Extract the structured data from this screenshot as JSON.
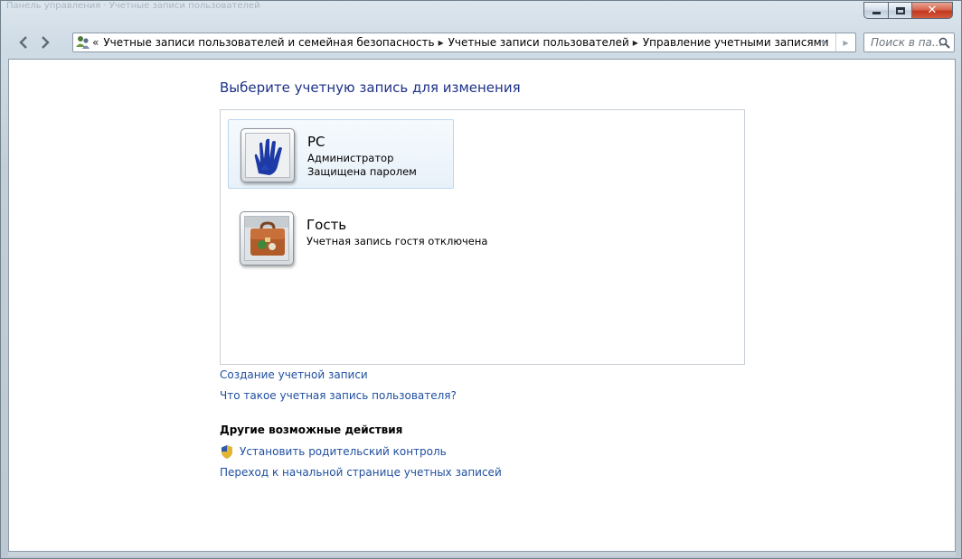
{
  "window": {
    "ghost_title": "Панель управления · Учетные записи пользователей"
  },
  "nav": {
    "crumb_lead": "«",
    "breadcrumbs": [
      "Учетные записи пользователей и семейная безопасность",
      "Учетные записи пользователей",
      "Управление учетными записями"
    ],
    "search_placeholder": "Поиск в па..."
  },
  "main": {
    "heading": "Выберите учетную запись для изменения",
    "accounts": [
      {
        "name": "PC",
        "lines": [
          "Администратор",
          "Защищена паролем"
        ],
        "icon": "blue-hand-icon",
        "selected": true
      },
      {
        "name": "Гость",
        "lines": [
          "Учетная запись гостя отключена"
        ],
        "icon": "suitcase-icon",
        "selected": false
      }
    ],
    "links": {
      "create": "Создание учетной записи",
      "what_is": "Что такое учетная запись пользователя?"
    },
    "other_actions": {
      "title": "Другие возможные действия",
      "parental": "Установить родительский контроль",
      "home": "Переход к начальной странице учетных записей"
    }
  },
  "colors": {
    "heading": "#1e3287",
    "link": "#1f4f9e",
    "selection_border": "#bcd6ee"
  }
}
